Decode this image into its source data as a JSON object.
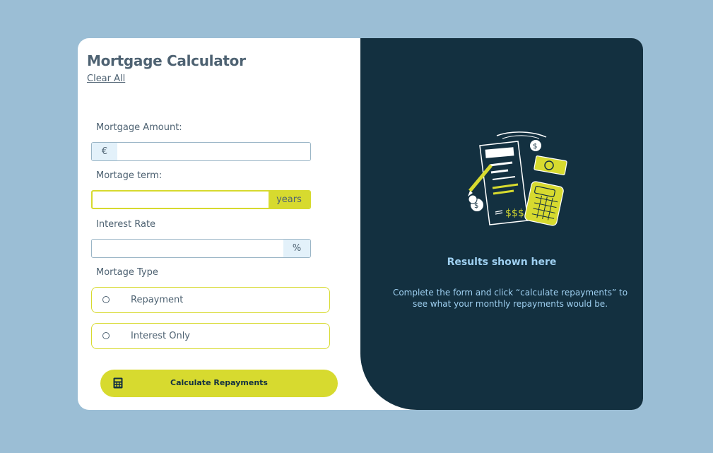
{
  "form": {
    "title": "Mortgage Calculator",
    "clear_label": "Clear All",
    "amount": {
      "label": "Mortgage Amount:",
      "prefix": "€",
      "value": ""
    },
    "term": {
      "label": "Mortage term:",
      "suffix": "years",
      "value": ""
    },
    "rate": {
      "label": "Interest Rate",
      "suffix": "%",
      "value": ""
    },
    "type": {
      "label": "Mortage Type",
      "options": [
        {
          "label": "Repayment",
          "selected": false
        },
        {
          "label": "Interest Only",
          "selected": false
        }
      ]
    },
    "calculate_label": "Calculate Repayments"
  },
  "results": {
    "title": "Results shown here",
    "text": "Complete the form and click “calculate repayments” to see what your monthly repayments would be."
  },
  "colors": {
    "accent": "#d7da2f",
    "panel": "#133040",
    "page_bg": "#9bbed5",
    "text": "#4e6272",
    "result_text": "#9ecff0"
  },
  "icons": {
    "calculate": "calculator-icon",
    "empty_state": "document-money-calculator-illustration"
  }
}
